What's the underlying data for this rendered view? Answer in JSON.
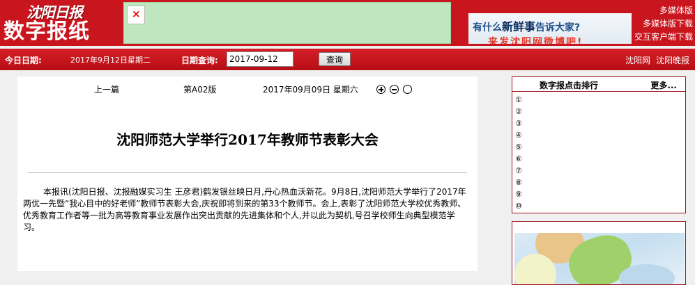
{
  "header": {
    "logo_brand": "沈阳日报",
    "logo_title": "数字报纸",
    "ad_right": {
      "line1_part1": "有什么",
      "line1_em": "新鲜事",
      "line1_part2": "告诉大家?",
      "line2": "来发沈阳网微博吧!"
    },
    "links": [
      "多媒体版",
      "多媒体版下载",
      "交互客户端下载"
    ],
    "colors": {
      "primary_red": "#c9151e",
      "ad_green": "#bfe7bf"
    }
  },
  "datebar": {
    "today_label": "今日日期:",
    "today_value": "2017年9月12日星期二",
    "query_label": "日期查询:",
    "date_input_value": "2017-09-12",
    "query_button": "查询",
    "site_links": [
      "沈阳网",
      "沈阳晚报"
    ]
  },
  "article": {
    "prev_link": "上一篇",
    "page_label": "第A02版",
    "date_label": "2017年09月09日 星期六",
    "headline": "沈阳师范大学举行2017年教师节表彰大会",
    "body": "本报讯(沈阳日报、沈报融媒实习生 王彦君)鹤发银丝映日月,丹心热血沃新花。9月8日,沈阳师范大学举行了2017年两优一先暨“我心目中的好老师”教师节表彰大会,庆祝即将到来的第33个教师节。会上,表彰了沈阳师范大学校优秀教师、优秀教育工作者等一批为高等教育事业发展作出突出贡献的先进集体和个人,并以此为契机,号召学校师生向典型模范学习。"
  },
  "sidebar": {
    "rank_title": "数字报点击排行",
    "rank_more": "更多...",
    "rank_items": [
      "①",
      "②",
      "③",
      "④",
      "⑤",
      "⑥",
      "⑦",
      "⑧",
      "⑨",
      "⑩"
    ]
  }
}
